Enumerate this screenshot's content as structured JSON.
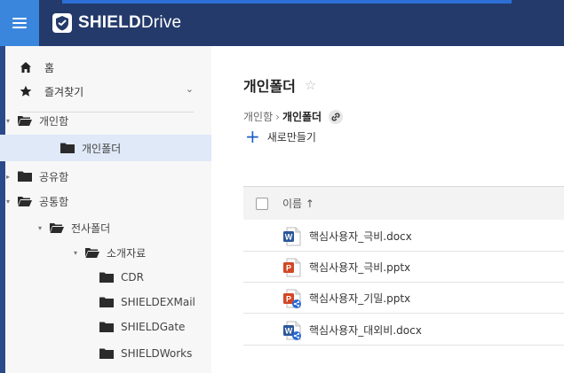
{
  "app": {
    "brand_bold": "SHIELD",
    "brand_light": "rive"
  },
  "sidebar": {
    "home_label": "홈",
    "favorites_label": "즐겨찾기",
    "items": [
      {
        "label": "개인함",
        "level": 0,
        "expanded": true
      },
      {
        "label": "개인폴더",
        "level": 1,
        "selected": true
      },
      {
        "label": "공유함",
        "level": 0,
        "expanded": false
      },
      {
        "label": "공통함",
        "level": 0,
        "expanded": true
      },
      {
        "label": "전사폴더",
        "level": 1,
        "expanded": true
      },
      {
        "label": "소개자료",
        "level": 2,
        "expanded": true
      },
      {
        "label": "CDR",
        "level": 3
      },
      {
        "label": "SHIELDEXMail",
        "level": 3
      },
      {
        "label": "SHIELDGate",
        "level": 3
      },
      {
        "label": "SHIELDWorks",
        "level": 3
      }
    ]
  },
  "main": {
    "title": "개인폴더",
    "breadcrumb": {
      "parent": "개인함",
      "separator": "›",
      "current": "개인폴더"
    },
    "new_button": "새로만들기",
    "table": {
      "name_header": "이름 ↑",
      "files": [
        {
          "name": "핵심사용자_극비.docx",
          "type": "word",
          "shared": false
        },
        {
          "name": "핵심사용자_극비.pptx",
          "type": "ppt",
          "shared": false
        },
        {
          "name": "핵심사용자_기밀.pptx",
          "type": "ppt",
          "shared": true
        },
        {
          "name": "핵심사용자_대외비.docx",
          "type": "word",
          "shared": true
        }
      ]
    }
  },
  "colors": {
    "topbar": "#243a6b",
    "menu_button": "#3b86dd",
    "accent": "#1c5fc6",
    "selected_row": "#dfe9f7",
    "folder": "#2b2b2b"
  }
}
